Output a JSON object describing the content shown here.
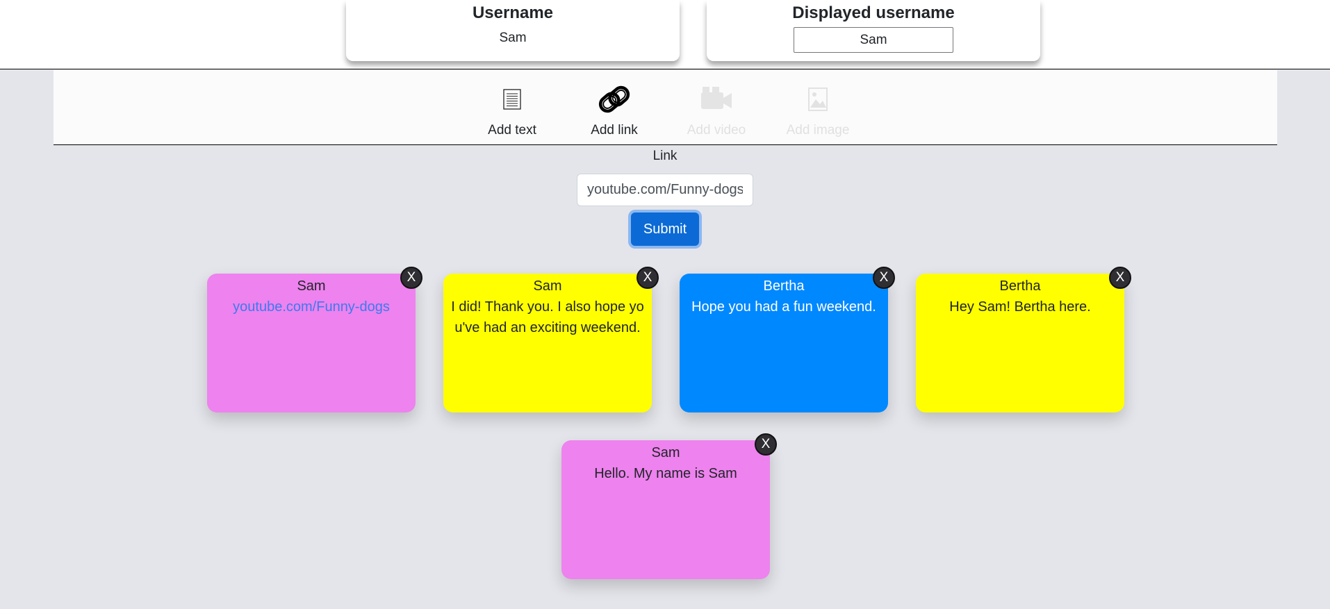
{
  "header": {
    "username_title": "Username",
    "username_value": "Sam",
    "displayed_title": "Displayed username",
    "displayed_value": "Sam"
  },
  "toolbar": {
    "tools": [
      {
        "label": "Add text",
        "icon": "document-icon",
        "enabled": true
      },
      {
        "label": "Add link",
        "icon": "chain-link-icon",
        "enabled": true
      },
      {
        "label": "Add video",
        "icon": "video-camera-icon",
        "enabled": false
      },
      {
        "label": "Add image",
        "icon": "image-icon",
        "enabled": false
      }
    ]
  },
  "form": {
    "label": "Link",
    "input_value": "youtube.com/Funny-dogs",
    "submit_label": "Submit"
  },
  "notes": [
    {
      "author": "Sam",
      "content": "youtube.com/Funny-dogs",
      "type": "link",
      "color": "#ee82ee",
      "close_label": "X"
    },
    {
      "author": "Sam",
      "content": "I did! Thank you. I also hope you've had an exciting weekend.",
      "type": "text",
      "color": "#ffff00",
      "close_label": "X"
    },
    {
      "author": "Bertha",
      "content": "Hope you had a fun weekend.",
      "type": "text",
      "color": "#0088ff",
      "close_label": "X"
    },
    {
      "author": "Bertha",
      "content": "Hey Sam! Bertha here.",
      "type": "text",
      "color": "#ffff00",
      "close_label": "X"
    },
    {
      "author": "Sam",
      "content": "Hello. My name is Sam",
      "type": "text",
      "color": "#ee82ee",
      "close_label": "X"
    }
  ]
}
